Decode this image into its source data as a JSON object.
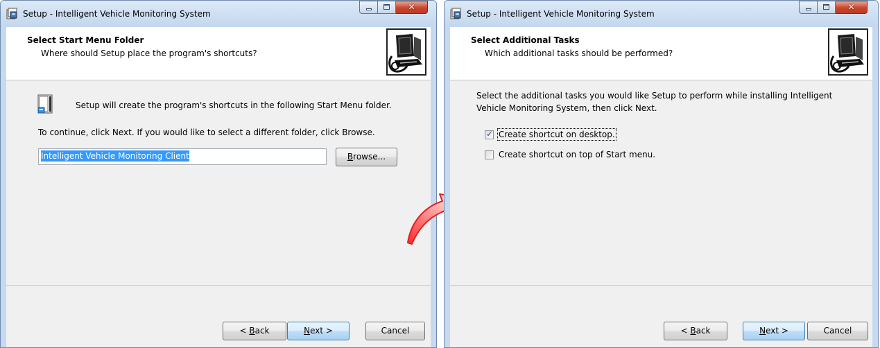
{
  "colors": {
    "titlebar": "#c7d9ee",
    "selection": "#3399ff",
    "close_button": "#c7462d",
    "arrow": "#e02020"
  },
  "left_window": {
    "title": "Setup - Intelligent Vehicle Monitoring System",
    "header_title": "Select Start Menu Folder",
    "header_subtitle": "Where should Setup place the program's shortcuts?",
    "info_text": "Setup will create the program's shortcuts in the following Start Menu folder.",
    "instruction": "To continue, click Next. If you would like to select a different folder, click Browse.",
    "folder_value": "Intelligent Vehicle Monitoring Client",
    "browse_pre": "B",
    "browse_rest": "rowse...",
    "back_pre": "< ",
    "back_u": "B",
    "back_rest": "ack",
    "next_u": "N",
    "next_rest": "ext >",
    "cancel": "Cancel",
    "icons": [
      "app-setup-icon",
      "wizard-computer-icon",
      "start-menu-folder-icon"
    ]
  },
  "right_window": {
    "title": "Setup - Intelligent Vehicle Monitoring System",
    "header_title": "Select Additional Tasks",
    "header_subtitle": "Which additional tasks should be performed?",
    "desc_line1": "Select the additional tasks you would like Setup to perform while installing Intelligent",
    "desc_line2": "Vehicle Monitoring System, then click Next.",
    "tasks": [
      {
        "label": "Create shortcut on desktop.",
        "checked": true
      },
      {
        "label": "Create shortcut on top of Start menu.",
        "checked": false
      }
    ],
    "back_pre": "< ",
    "back_u": "B",
    "back_rest": "ack",
    "next_u": "N",
    "next_rest": "ext >",
    "cancel": "Cancel"
  }
}
